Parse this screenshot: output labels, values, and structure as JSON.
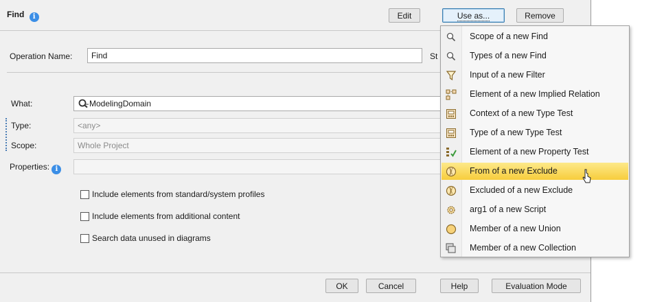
{
  "dialog": {
    "title": "Find",
    "buttons": {
      "edit": "Edit",
      "use_as": "Use as...",
      "remove": "Remove"
    },
    "operation_name_label": "Operation Name:",
    "operation_name_value": "Find",
    "partial_label": "St",
    "what_label": "What:",
    "what_value": "ModelingDomain",
    "type_label": "Type:",
    "type_value": "<any>",
    "scope_label": "Scope:",
    "scope_value": "Whole Project",
    "properties_label": "Properties:",
    "checkboxes": [
      {
        "label": "Include elements from standard/system profiles",
        "checked": false
      },
      {
        "label": "Include elements from additional content",
        "checked": false
      },
      {
        "label": "Search data unused in diagrams",
        "checked": false
      }
    ],
    "footer": {
      "ok": "OK",
      "cancel": "Cancel",
      "help": "Help",
      "evaluation_mode": "Evaluation Mode"
    }
  },
  "use_as_menu": {
    "items": [
      {
        "label": "Scope of a new Find",
        "icon": "magnifier-icon"
      },
      {
        "label": "Types of a new Find",
        "icon": "magnifier-icon"
      },
      {
        "label": "Input of a new Filter",
        "icon": "filter-icon"
      },
      {
        "label": "Element of a new Implied Relation",
        "icon": "implied-relation-icon"
      },
      {
        "label": "Context of a new Type Test",
        "icon": "type-test-icon"
      },
      {
        "label": "Type of a new Type Test",
        "icon": "type-test-icon"
      },
      {
        "label": "Element of a new Property Test",
        "icon": "property-test-icon"
      },
      {
        "label": "From of a new Exclude",
        "icon": "exclude-icon",
        "highlighted": true
      },
      {
        "label": "Excluded of a new Exclude",
        "icon": "exclude-icon"
      },
      {
        "label": "arg1 of a new Script",
        "icon": "script-gear-icon"
      },
      {
        "label": "Member of a new Union",
        "icon": "union-icon"
      },
      {
        "label": "Member of a new Collection",
        "icon": "collection-icon"
      }
    ]
  },
  "colors": {
    "highlight": "#f9d64f",
    "info": "#3b8ee6",
    "accent_border": "#3c7fb1"
  }
}
